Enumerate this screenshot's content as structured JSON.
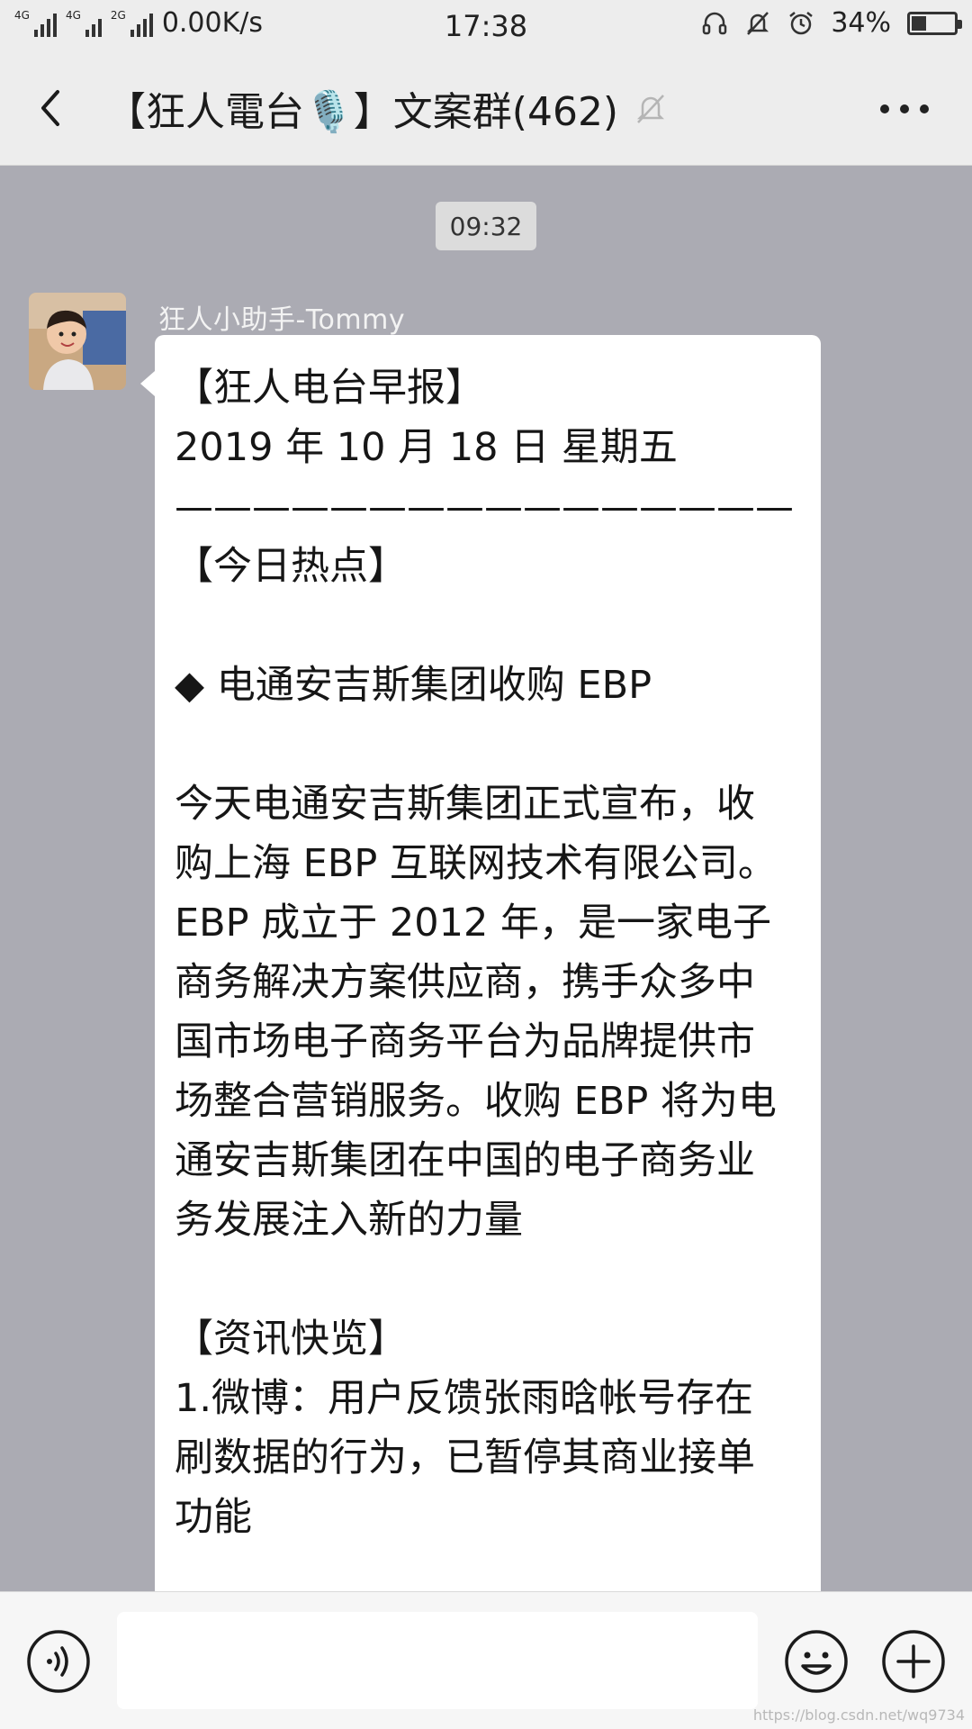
{
  "status_bar": {
    "network_1": "4G",
    "network_2": "4G",
    "network_3": "2G",
    "speed": "0.00K/s",
    "time": "17:38",
    "battery": "34%",
    "battery_level": 0.34
  },
  "header": {
    "title": "【狂人電台🎙️】文案群(462)"
  },
  "chat": {
    "timestamp": "09:32",
    "sender": "狂人小助手-Tommy",
    "message_lines": [
      "【狂人电台早报】",
      "2019 年 10 月 18 日 星期五",
      "————————————————",
      "【今日热点】",
      "",
      "◆ 电通安吉斯集团收购 EBP",
      "",
      "今天电通安吉斯集团正式宣布，收",
      "购上海 EBP 互联网技术有限公司。",
      "EBP 成立于 2012 年，是一家电子",
      "商务解决方案供应商，携手众多中",
      "国市场电子商务平台为品牌提供市",
      "场整合营销服务。收购 EBP 将为电",
      "通安吉斯集团在中国的电子商务业",
      "务发展注入新的力量",
      "",
      "【资讯快览】",
      "1.微博：用户反馈张雨晗帐号存在",
      "刷数据的行为，已暂停其商业接单",
      "功能"
    ]
  },
  "input_bar": {
    "placeholder": ""
  },
  "watermark": "https://blog.csdn.net/wq9734",
  "colors": {
    "chat_background": "#ababb3",
    "bubble": "#ffffff",
    "bar": "#ededed"
  }
}
